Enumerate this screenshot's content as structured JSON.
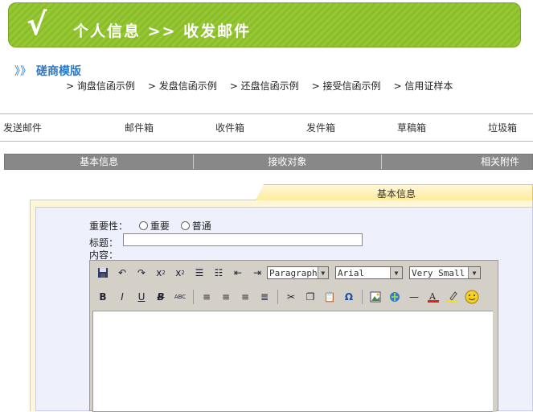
{
  "header": {
    "title": "个人信息 >> 收发邮件"
  },
  "template": {
    "arrows": "》》",
    "title": "磋商模版",
    "links": [
      "> 询盘信函示例",
      "> 发盘信函示例",
      "> 还盘信函示例",
      "> 接受信函示例",
      "> 信用证样本"
    ]
  },
  "mailnav": {
    "send": "发送邮件",
    "mailbox": "邮件箱",
    "inbox": "收件箱",
    "outbox": "发件箱",
    "drafts": "草稿箱",
    "trash": "垃圾箱"
  },
  "tabs": [
    "基本信息",
    "接收对象",
    "相关附件"
  ],
  "panel": {
    "active_tab": "基本信息",
    "importance_label": "重要性：",
    "importance_options": [
      "重要",
      "普通"
    ],
    "subject_label": "标题：",
    "subject_value": "",
    "content_label": "内容："
  },
  "editor": {
    "format_select": "Paragraph",
    "font_select": "Arial",
    "size_select": "Very Small"
  }
}
